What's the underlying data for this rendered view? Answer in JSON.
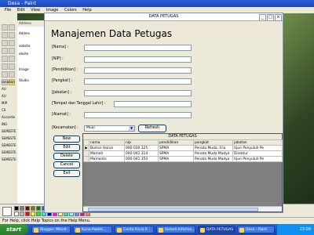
{
  "paint": {
    "title": "Desa - Paint",
    "menu": [
      "File",
      "Edit",
      "View",
      "Image",
      "Colors",
      "Help"
    ],
    "status": "For Help, click Help Topics on the Help Menu."
  },
  "explorer": {
    "address_label": "Address",
    "lines": [
      "Addres",
      "sebsite",
      "ebsite",
      "Image",
      "Studio"
    ]
  },
  "side_list": [
    "ronation",
    "AU",
    "AU",
    "MIP",
    "CS",
    "Accordin",
    "ING",
    "SEMESTE",
    "SEMESTE",
    "SEMESTE",
    "SEMESTE",
    "SEMESTE"
  ],
  "dialog": {
    "title": "DATA PETUGAS",
    "heading": "Manajemen Data Petugas",
    "fields": [
      {
        "label": "[Nama] :",
        "value": ""
      },
      {
        "label": "[NIP] :",
        "value": ""
      },
      {
        "label": "[Pendidikan] :",
        "value": ""
      },
      {
        "label": "[Pangkat] :",
        "value": ""
      },
      {
        "label": "[Jabatan] :",
        "value": ""
      },
      {
        "label": "[Tempat dan Tanggal Lahir] :",
        "value": ""
      },
      {
        "label": "[Alamat] :",
        "value": ""
      }
    ],
    "kecamatan_label": "[Kecamatan] :",
    "kecamatan_value": "Muai",
    "refresh_label": "Refresh",
    "buttons": {
      "new": "New",
      "edit": "Edit",
      "delete": "Delete",
      "cancel": "Cancel",
      "exit": "Exit"
    },
    "table": {
      "caption": "DATA PETUGAS",
      "columns": [
        "",
        "nama",
        "nip",
        "pendidikan",
        "pangkat",
        "jabatan"
      ],
      "rows": [
        [
          "▶",
          "Bumor Harun",
          "0X0 030 325",
          "SPMA",
          "Penata Muda, II Ia",
          "Ujun Penyuluh Pe"
        ],
        [
          "",
          "Mamah",
          "0X0 041 314",
          "SPMA",
          "Penata Muda Madya",
          "Direktur"
        ],
        [
          "",
          "Mamanto",
          "0X0 041 350",
          "SPMA",
          "Penata Muda Madya",
          "Ujun Penyuluh Pe"
        ]
      ]
    }
  },
  "taskbar": {
    "start_label": "start",
    "tasks": [
      "Blogger: Mikolt...",
      "Karia-Poklet...",
      "Cerita Karia P...",
      "Sistem Informa...",
      "DATA PETUGAS",
      "Desa - Paint"
    ],
    "clock": "23:09"
  },
  "colors": {
    "palette": [
      "#000000",
      "#808080",
      "#800000",
      "#808000",
      "#008000",
      "#008080",
      "#000080",
      "#800080",
      "#808040",
      "#004040",
      "#0080ff",
      "#004080",
      "#8000ff",
      "#804000",
      "#ffffff",
      "#c0c0c0",
      "#ff0000",
      "#ffff00",
      "#00ff00",
      "#00ffff",
      "#0000ff",
      "#ff00ff",
      "#ffff80",
      "#00ff80",
      "#80ffff",
      "#8080ff",
      "#ff0080",
      "#ff8040"
    ]
  }
}
